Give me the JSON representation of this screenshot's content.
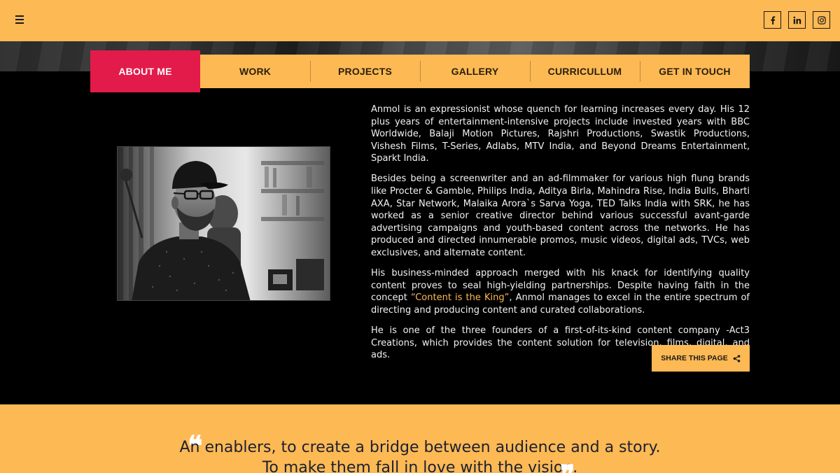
{
  "header": {
    "menu_icon": "hamburger-icon",
    "social": [
      {
        "name": "facebook",
        "icon": "facebook-icon"
      },
      {
        "name": "linkedin",
        "icon": "linkedin-icon"
      },
      {
        "name": "instagram",
        "icon": "instagram-icon"
      }
    ]
  },
  "nav": {
    "items": [
      {
        "label": "ABOUT ME",
        "active": true
      },
      {
        "label": "WORK"
      },
      {
        "label": "PROJECTS"
      },
      {
        "label": "GALLERY"
      },
      {
        "label": "CURRICULLUM"
      },
      {
        "label": "GET IN TOUCH"
      }
    ]
  },
  "bio": {
    "p1": "Anmol is an expressionist whose quench for learning increases every day. His 12 plus years of entertainment-intensive projects include invested years with BBC Worldwide, Balaji Motion Pictures, Rajshri Productions, Swastik Productions, Vishesh Films, T-Series, Adlabs, MTV India, and Beyond Dreams Entertainment, Sparkt India.",
    "p2": "Besides being a screenwriter and an ad-filmmaker for various high flung brands like Procter & Gamble, Philips India, Aditya Birla, Mahindra Rise, India Bulls, Bharti AXA, Star Network, Malaika Arora`s Sarva Yoga, TED Talks India with SRK, he has worked as a senior creative director behind various successful avant-garde advertising campaigns and youth-based content across the networks. He has produced and directed innumerable promos, music videos, digital ads, TVCs, web exclusives, and alternate content.",
    "p3_before": "His business-minded approach merged with his knack for identifying quality content proves to seal high-yielding partnerships. Despite having faith in the concept ",
    "p3_highlight": "“Content is the King”",
    "p3_after": ", Anmol manages to excel in the entire spectrum of directing and producing content and curated collaborations.",
    "p4": "He is one of the three founders of a first-of-its-kind content company -Act3 Creations, which provides the content solution for television, films, digital, and ads."
  },
  "share": {
    "label": "SHARE THIS PAGE",
    "icon": "share-icon"
  },
  "quote": {
    "line1": "An enablers, to create a bridge between audience and a story.",
    "line2": "To make them fall in love with the vision.",
    "open_mark": "❝",
    "close_mark": "❞"
  },
  "colors": {
    "accent": "#fdb954",
    "active_tab": "#e31b4b",
    "background": "#000000"
  }
}
